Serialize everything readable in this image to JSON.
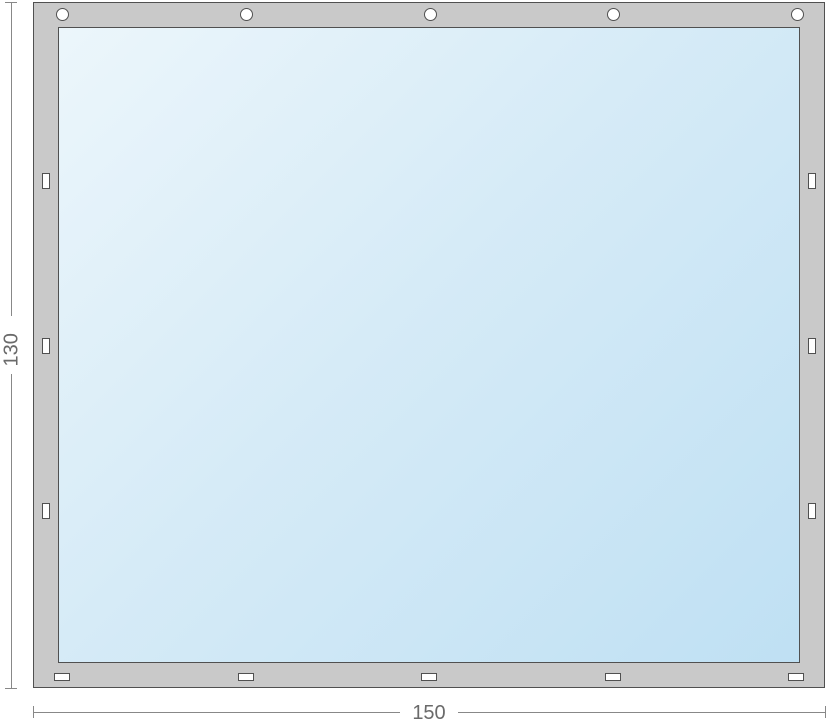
{
  "dimensions": {
    "width_label": "150",
    "height_label": "130"
  },
  "frame": {
    "border_color": "#505050",
    "fill_color": "#c9c9c9"
  },
  "pane": {
    "gradient_start": "#ecf6fb",
    "gradient_end": "#bfe0f3"
  },
  "grommets_top_count": 5,
  "side_slots_per_side": 3,
  "bottom_slots_count": 5
}
